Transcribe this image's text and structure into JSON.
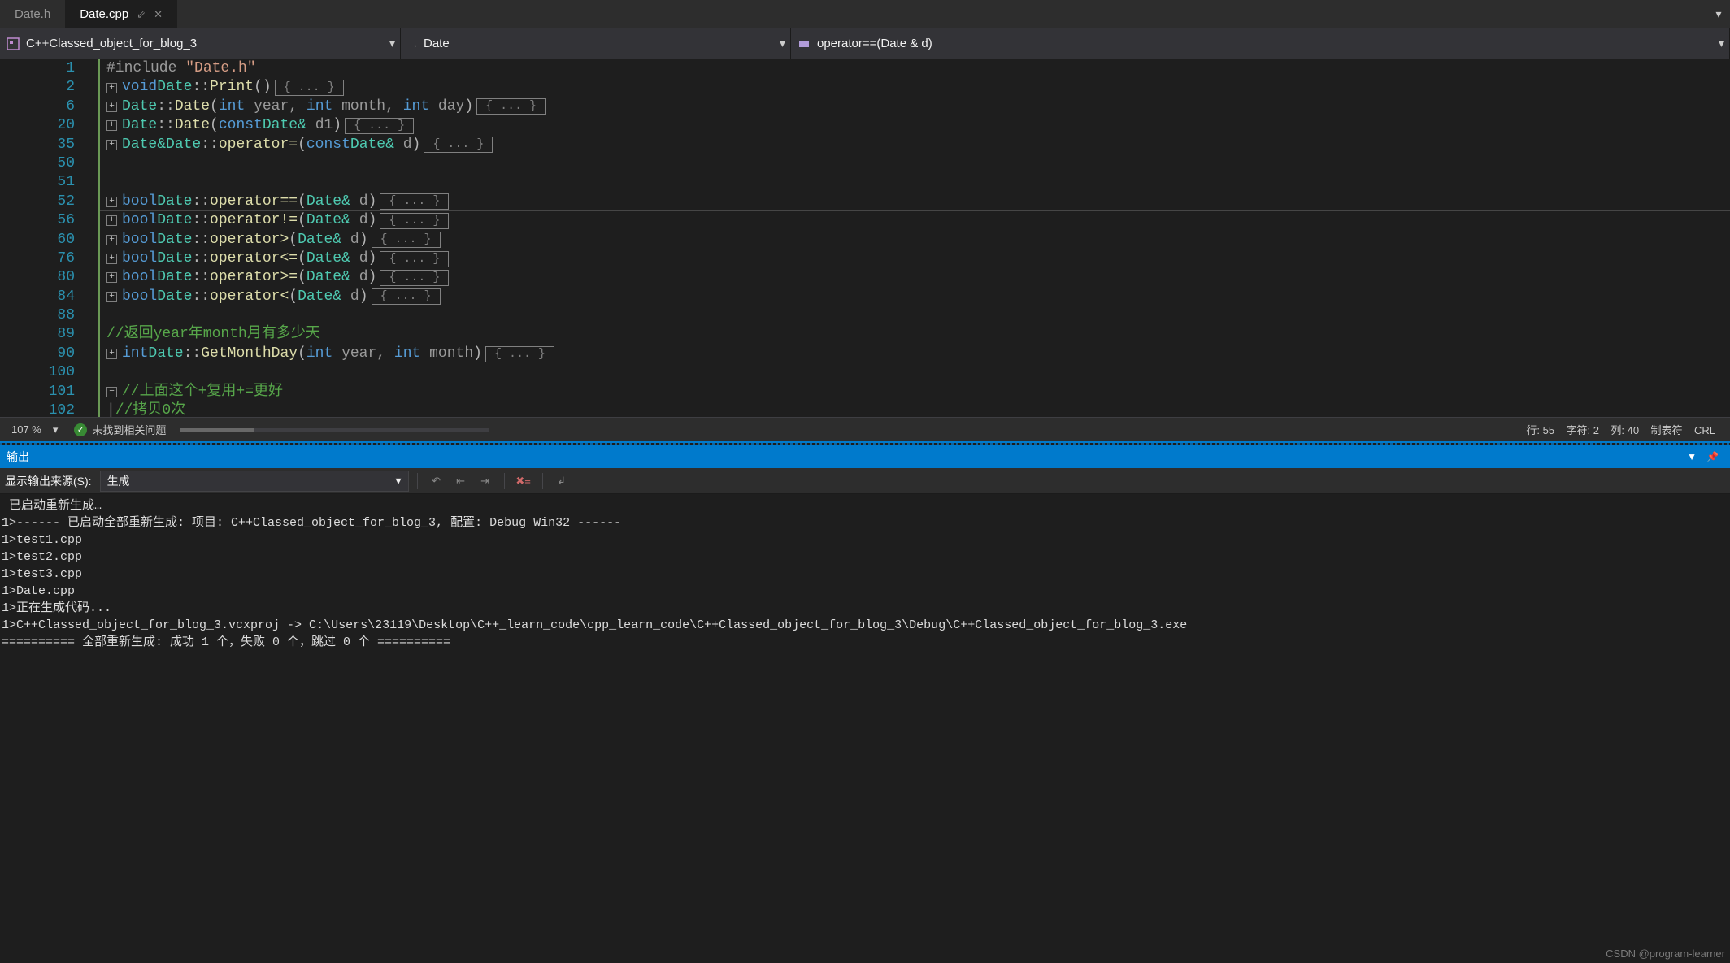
{
  "tabs": {
    "inactive": "Date.h",
    "active": "Date.cpp",
    "pin": "⇙",
    "close": "✕"
  },
  "crumbs": {
    "scope": "C++Classed_object_for_blog_3",
    "class": "Date",
    "member": "operator==(Date & d)"
  },
  "gutter": [
    "1",
    "2",
    "6",
    "20",
    "35",
    "50",
    "51",
    "52",
    "56",
    "60",
    "76",
    "80",
    "84",
    "88",
    "89",
    "90",
    "100",
    "101",
    "102"
  ],
  "code": {
    "include_pre": "#include ",
    "include_str": "\"Date.h\"",
    "void": "void",
    "bool": "bool",
    "int": "int",
    "const": "const",
    "Date": "Date",
    "Date_amp": "Date&",
    "amp_d": "& d",
    "amp_d1": "& d1",
    "Print": "Print",
    "op_assign": "operator=",
    "op_eq": "operator==",
    "op_ne": "operator!=",
    "op_gt": "operator>",
    "op_le": "operator<=",
    "op_ge": "operator>=",
    "op_lt": "operator<",
    "GetMonthDay": "GetMonthDay",
    "params_ctor": "int year, int month, int day",
    "params_gmd": "int year, int month",
    "comment_gmd": "//返回year年month月有多少天",
    "comment_a": "//上面这个+复用+=更好",
    "comment_b": "//拷贝0次",
    "collapsed": "{ ... }",
    "plus": "+",
    "minus": "−",
    "scope_sep": "::",
    "lpar": "(",
    "rpar": ")",
    "empty_par": "()"
  },
  "zoom": {
    "pct": "107 %",
    "ok": "未找到相关问题",
    "cursor": "行: 55    字符: 2    列: 40    制表符    CRL"
  },
  "outputHeader": "输出",
  "outputToolbar": {
    "label": "显示输出来源(S):",
    "source": "生成"
  },
  "outputLines": [
    " 已启动重新生成…",
    "1>------ 已启动全部重新生成: 项目: C++Classed_object_for_blog_3, 配置: Debug Win32 ------",
    "1>test1.cpp",
    "1>test2.cpp",
    "1>test3.cpp",
    "1>Date.cpp",
    "1>正在生成代码...",
    "1>C++Classed_object_for_blog_3.vcxproj -> C:\\Users\\23119\\Desktop\\C++_learn_code\\cpp_learn_code\\C++Classed_object_for_blog_3\\Debug\\C++Classed_object_for_blog_3.exe",
    "========== 全部重新生成: 成功 1 个，失败 0 个，跳过 0 个 =========="
  ],
  "watermark": "CSDN @program-learner"
}
